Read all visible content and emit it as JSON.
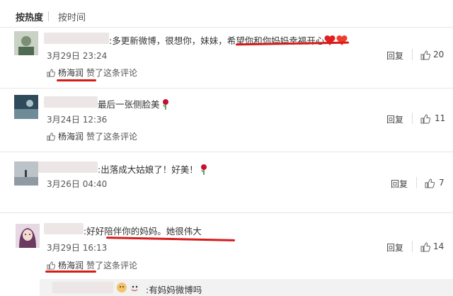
{
  "sort_tabs": {
    "hot": "按热度",
    "time": "按时间"
  },
  "reply_label": "回复",
  "liked_user": "杨海润",
  "liked_suffix": "赞了这条评论",
  "comments": [
    {
      "text": ":多更新微博，很想你，妹妹，希望你和你妈妈幸福开心",
      "time": "3月29日 23:24",
      "likes": "20"
    },
    {
      "text": "最后一张侧脸美",
      "time": "3月24日 12:36",
      "likes": "11"
    },
    {
      "text": ":出落成大姑娘了！好美！",
      "time": "3月26日 04:40",
      "likes": "7"
    },
    {
      "text": ":好好陪伴你的妈妈。她很伟大",
      "time": "3月29日 16:13",
      "likes": "14"
    }
  ],
  "subreply_text": ":有妈妈微博吗"
}
